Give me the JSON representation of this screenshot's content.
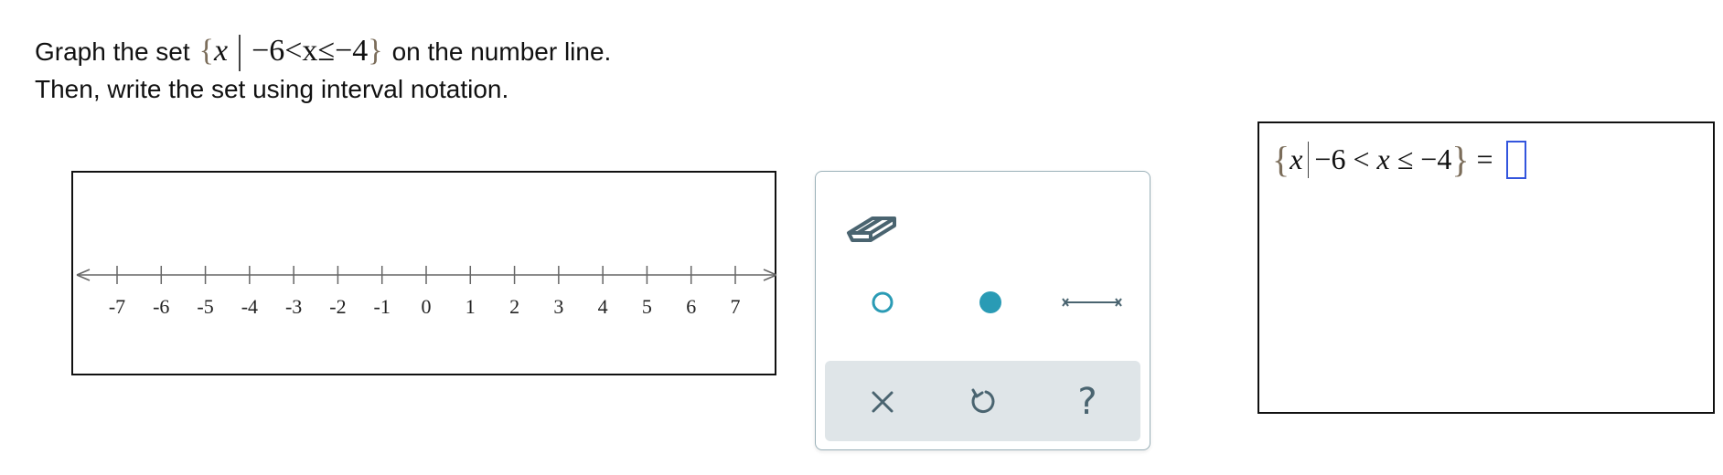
{
  "prompt": {
    "line1_before": "Graph the set",
    "line1_math": {
      "open_brace": "{",
      "var": "x",
      "condition": "−6<x≤−4",
      "close_brace": "}"
    },
    "line1_after": "on the number line.",
    "line2": "Then, write the set using interval notation."
  },
  "number_line": {
    "min": -7,
    "max": 7,
    "ticks": [
      "-7",
      "-6",
      "-5",
      "-4",
      "-3",
      "-2",
      "-1",
      "0",
      "1",
      "2",
      "3",
      "4",
      "5",
      "6",
      "7"
    ]
  },
  "tools": {
    "eraser": "eraser-icon",
    "open_point": "open-circle-icon",
    "closed_point": "closed-circle-icon",
    "segment": "segment-icon",
    "clear": "×",
    "undo": "undo-icon",
    "help": "?"
  },
  "answer": {
    "open_brace": "{",
    "var": "x",
    "left": "−6 <",
    "var2": "x",
    "right": "≤ −4",
    "close_brace": "}",
    "equals": "="
  },
  "colors": {
    "accent": "#2a9bb5",
    "icon": "#4a6470",
    "input_border": "#3355dd",
    "toolbar_bg": "#dfe5e8"
  }
}
